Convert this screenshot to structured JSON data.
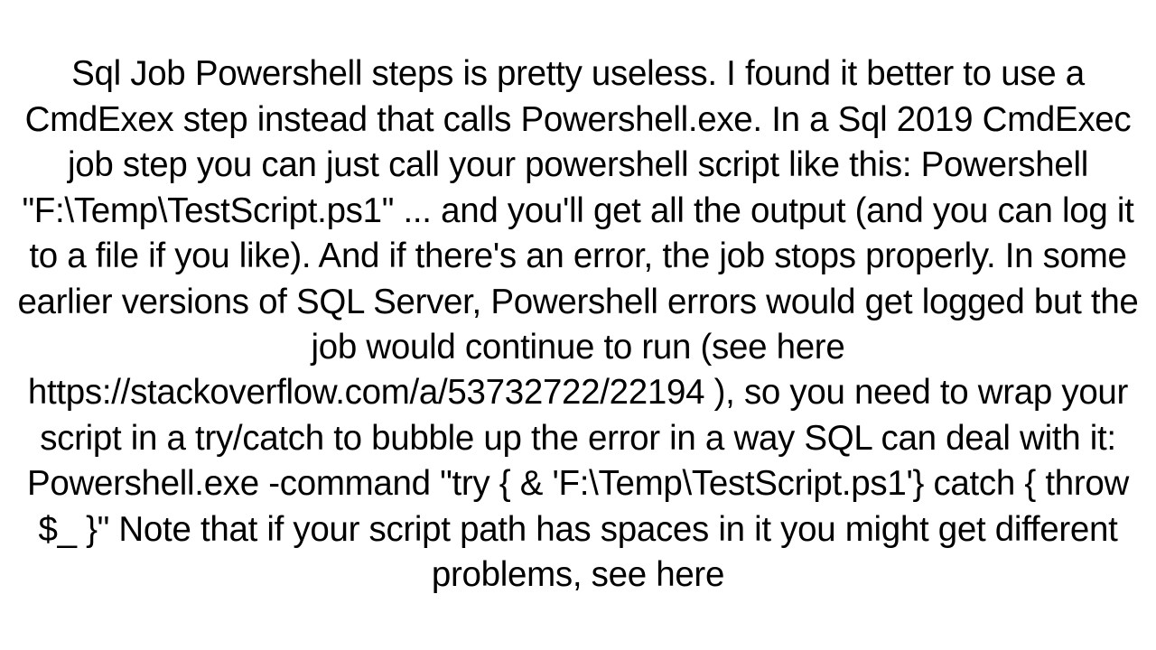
{
  "paragraph": {
    "text": "Sql Job Powershell steps is pretty useless. I found it better to use a CmdExex step instead that calls Powershell.exe. In a Sql 2019 CmdExec job step you can just call your powershell script like this: Powershell \"F:\\Temp\\TestScript.ps1\"  ... and you'll get all the output (and you can log it to a file if you like). And if there's an error, the job stops properly. In some earlier versions of SQL Server, Powershell errors would get logged but the job would continue to run (see here https://stackoverflow.com/a/53732722/22194 ), so you need to wrap your script in a try/catch to bubble up the error in a way SQL can deal with it: Powershell.exe -command \"try { & 'F:\\Temp\\TestScript.ps1'} catch { throw $_ }\"  Note that if your script path has spaces in it you might get different problems, see here"
  }
}
